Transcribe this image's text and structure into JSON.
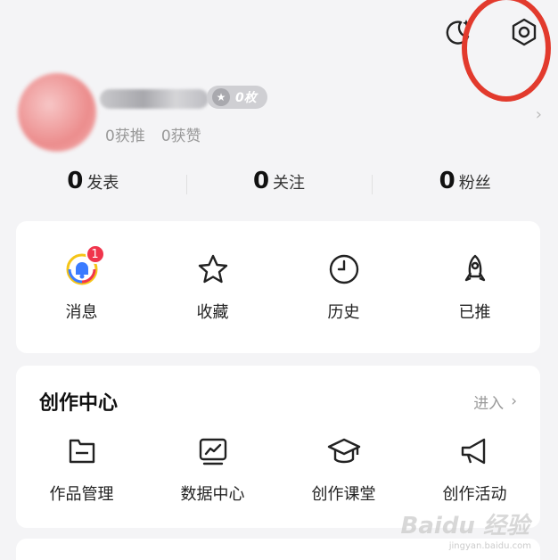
{
  "top": {
    "icons": [
      "moon-icon",
      "settings-icon"
    ]
  },
  "profile": {
    "coin_count": "0枚",
    "recommend_label": "0获推",
    "likes_label": "0获赞"
  },
  "stats": [
    {
      "num": "0",
      "label": "发表"
    },
    {
      "num": "0",
      "label": "关注"
    },
    {
      "num": "0",
      "label": "粉丝"
    }
  ],
  "quick": {
    "items": [
      {
        "label": "消息",
        "icon": "message-bell-icon",
        "badge": "1"
      },
      {
        "label": "收藏",
        "icon": "star-icon"
      },
      {
        "label": "历史",
        "icon": "clock-icon"
      },
      {
        "label": "已推",
        "icon": "rocket-icon"
      }
    ]
  },
  "creation": {
    "title": "创作中心",
    "enter_label": "进入",
    "items": [
      {
        "label": "作品管理",
        "icon": "folder-icon"
      },
      {
        "label": "数据中心",
        "icon": "chart-icon"
      },
      {
        "label": "创作课堂",
        "icon": "graduation-cap-icon"
      },
      {
        "label": "创作活动",
        "icon": "megaphone-icon"
      }
    ]
  },
  "watermark": {
    "text": "Baidu 经验",
    "sub": "jingyan.baidu.com"
  },
  "colors": {
    "annotation": "#e23a2d",
    "badge": "#f0354c",
    "page_bg": "#f4f4f6"
  }
}
